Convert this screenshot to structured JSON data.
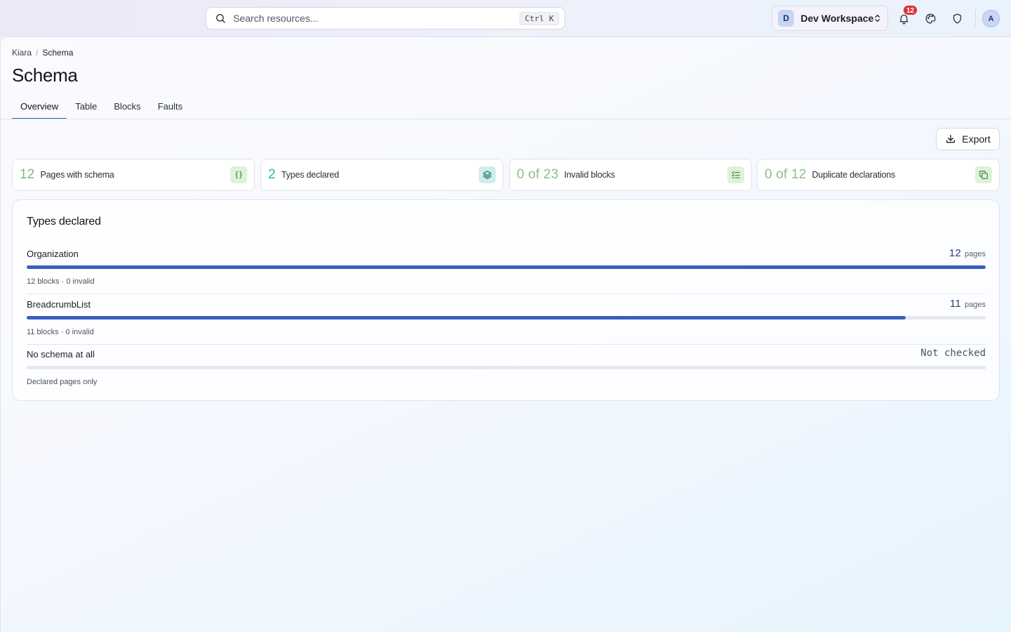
{
  "search": {
    "placeholder": "Search resources...",
    "shortcut": "Ctrl K"
  },
  "workspace": {
    "initial": "D",
    "name": "Dev Workspace"
  },
  "notifications": {
    "count": "12"
  },
  "user": {
    "initial": "A"
  },
  "breadcrumb": [
    "Kiara",
    "Schema"
  ],
  "page": {
    "title": "Schema"
  },
  "tabs": [
    {
      "label": "Overview",
      "active": true
    },
    {
      "label": "Table",
      "active": false
    },
    {
      "label": "Blocks",
      "active": false
    },
    {
      "label": "Faults",
      "active": false
    }
  ],
  "actions": {
    "export_label": "Export"
  },
  "stats": [
    {
      "value": "12",
      "label": "Pages with schema",
      "icon": "braces-icon",
      "color": "#7fb879",
      "icon_bg": "#def1d9"
    },
    {
      "value": "2",
      "label": "Types declared",
      "icon": "layers-icon",
      "color": "#2db3ad",
      "icon_bg": "#cfeeec"
    },
    {
      "value": "0 of 23",
      "label": "Invalid blocks",
      "icon": "checklist-icon",
      "color": "#8cbf86",
      "icon_bg": "#def1d9"
    },
    {
      "value": "0 of 12",
      "label": "Duplicate declarations",
      "icon": "copy-icon",
      "color": "#8cbf86",
      "icon_bg": "#def1d9"
    }
  ],
  "types_card": {
    "title": "Types declared",
    "rows": [
      {
        "name": "Organization",
        "count": "12",
        "unit": "pages",
        "fraction": 1.0,
        "meta": "12 blocks · 0 invalid"
      },
      {
        "name": "BreadcrumbList",
        "count": "11",
        "unit": "pages",
        "fraction": 0.9167,
        "meta": "11 blocks · 0 invalid"
      },
      {
        "name": "No schema at all",
        "status": "Not checked",
        "fraction": 0,
        "meta": "Declared pages only"
      }
    ]
  },
  "colors": {
    "accent": "#3a5fbf",
    "badge": "#d9333b"
  }
}
